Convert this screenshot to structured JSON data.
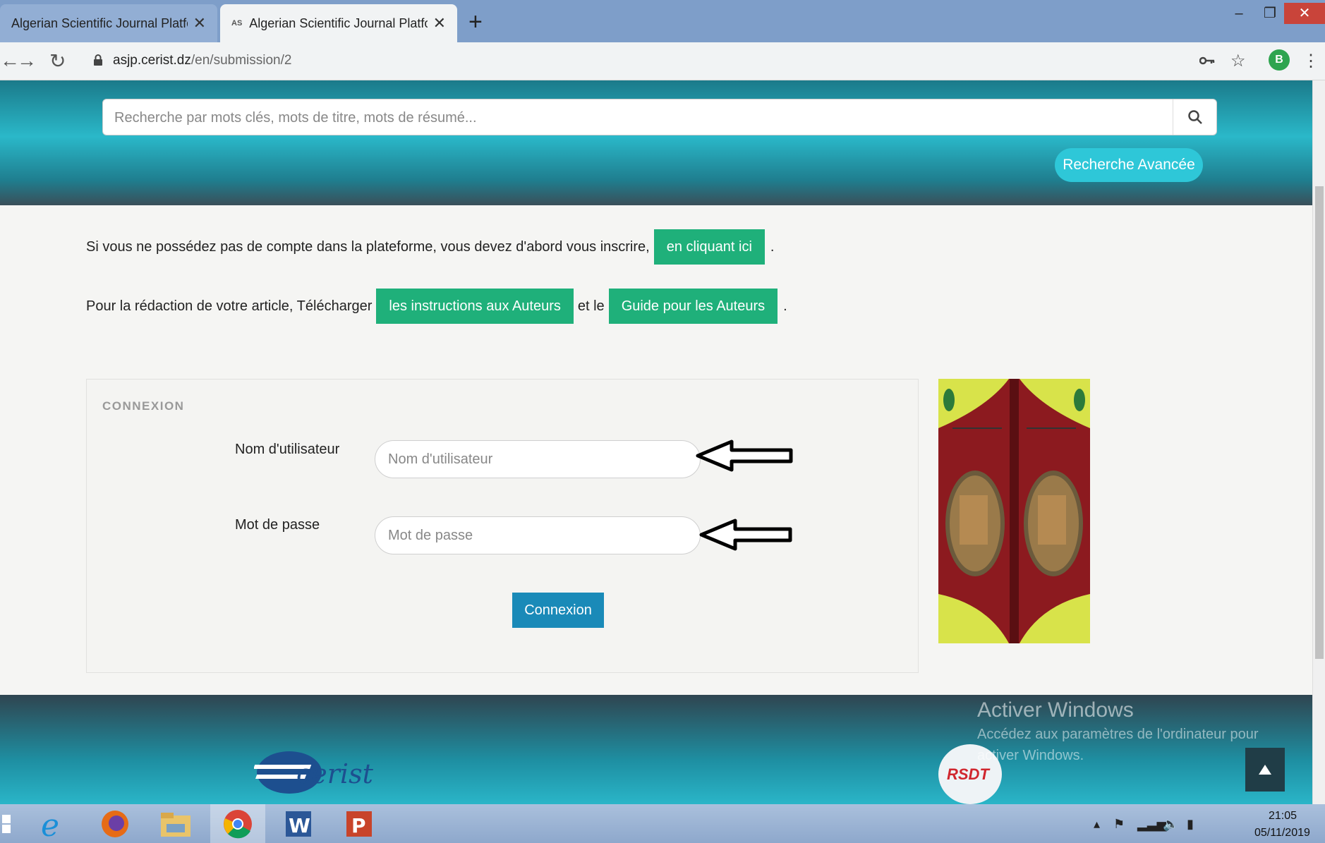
{
  "browser": {
    "tabs": [
      {
        "title": "Algerian Scientific Journal Platfor",
        "close": "✕"
      },
      {
        "title": "Algerian Scientific Journal Platfor",
        "favicon": "AS",
        "close": "✕"
      }
    ],
    "new_tab": "+",
    "window_controls": {
      "minimize": "–",
      "restore": "❐",
      "close": "✕"
    },
    "url_host": "asjp.cerist.dz",
    "url_path": "/en/submission/2",
    "profile_initial": "B"
  },
  "search": {
    "placeholder": "Recherche par mots clés, mots de titre, mots de résumé...",
    "advanced_label": "Recherche Avancée"
  },
  "intro": {
    "line1_text": "Si vous ne possédez pas de compte dans la plateforme, vous devez d'abord vous inscrire,",
    "line1_button": "en cliquant ici",
    "line1_end": ".",
    "line2_text": "Pour la rédaction de votre article, Télécharger",
    "line2_button1": "les instructions aux Auteurs",
    "line2_mid": "et le",
    "line2_button2": "Guide pour les Auteurs",
    "line2_end": "."
  },
  "login": {
    "panel_title": "CONNEXION",
    "username_label": "Nom d'utilisateur",
    "username_placeholder": "Nom d'utilisateur",
    "password_label": "Mot de passe",
    "password_placeholder": "Mot de passe",
    "submit_label": "Connexion"
  },
  "footer": {
    "logo_text": "cerist",
    "rsdt_text": "RSDT"
  },
  "watermark": {
    "title": "Activer Windows",
    "line1": "Accédez aux paramètres de l'ordinateur pour",
    "line2": "activer Windows."
  },
  "taskbar": {
    "time": "21:05",
    "date": "05/11/2019",
    "apps": [
      "internet-explorer",
      "firefox",
      "file-explorer",
      "chrome",
      "word",
      "powerpoint"
    ]
  },
  "colors": {
    "primary_green": "#1fb07a",
    "login_blue": "#1a8ab8",
    "advanced_cyan": "#2ec7d8"
  }
}
